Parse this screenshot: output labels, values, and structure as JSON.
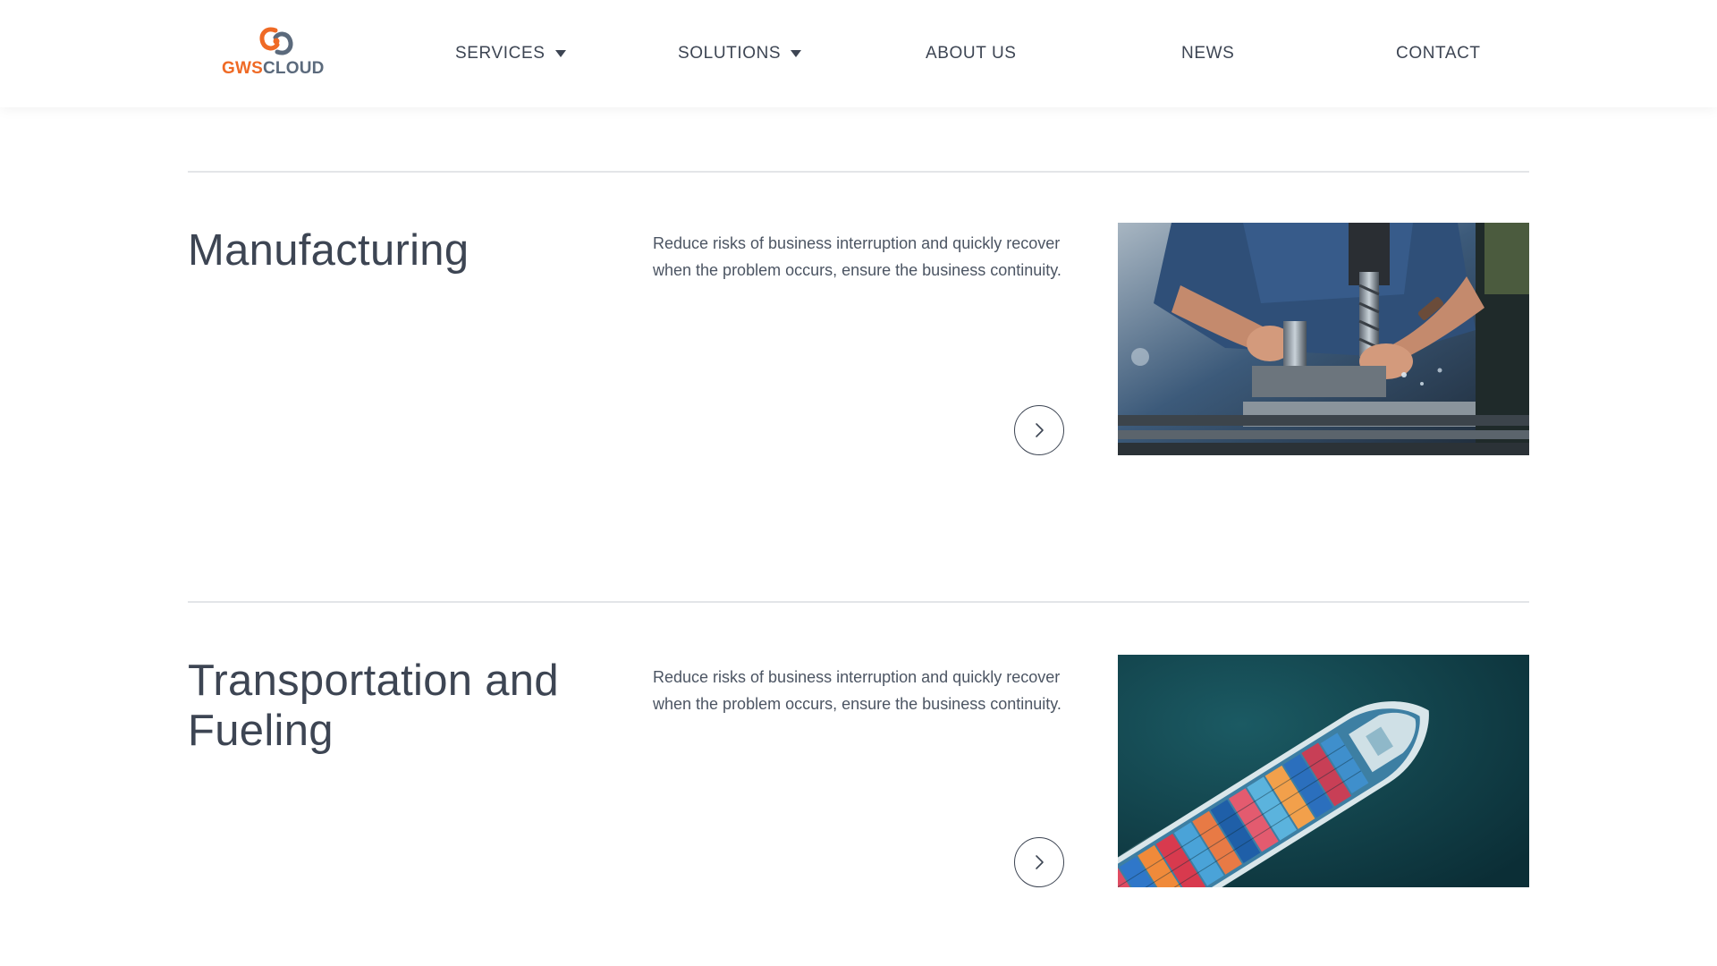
{
  "brand": {
    "logo_text_part1": "GWS",
    "logo_text_part2": "CLOUD",
    "colors": {
      "orange": "#ef6a25",
      "slate": "#5b6a7c"
    }
  },
  "nav": {
    "items": [
      {
        "label": "SERVICES",
        "has_dropdown": true
      },
      {
        "label": "SOLUTIONS",
        "has_dropdown": true
      },
      {
        "label": "ABOUT US",
        "has_dropdown": false
      },
      {
        "label": "NEWS",
        "has_dropdown": false
      },
      {
        "label": "CONTACT",
        "has_dropdown": false
      }
    ]
  },
  "sections": [
    {
      "title": "Manufacturing",
      "description": "Reduce risks of business interruption and quickly recover when the problem occurs, ensure the business continuity.",
      "image": "milling-machine-photo",
      "action_icon": "chevron-right-icon"
    },
    {
      "title": "Transportation and Fueling",
      "description": "Reduce risks of business interruption and quickly recover when the problem occurs, ensure the business continuity.",
      "image": "container-ship-aerial-photo",
      "action_icon": "chevron-right-icon"
    }
  ],
  "theme": {
    "text": "#3d4553",
    "divider": "#e3e5e8",
    "background": "#ffffff"
  }
}
